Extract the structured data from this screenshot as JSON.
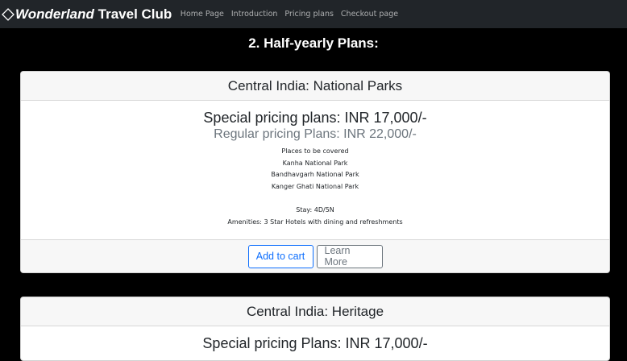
{
  "navbar": {
    "brand_part1": "Wonderland",
    "brand_part2": " Travel Club",
    "links": [
      "Home Page",
      "Introduction",
      "Pricing plans",
      "Checkout page"
    ]
  },
  "section": {
    "title": "2. Half-yearly Plans:"
  },
  "cards": [
    {
      "header": "Central India: National Parks",
      "special_price": "Special pricing plans: INR 17,000/-",
      "regular_price": "Regular pricing Plans: INR 22,000/-",
      "places_label": "Places to be covered",
      "places": [
        "Kanha National Park",
        "Bandhavgarh National Park",
        "Kanger Ghati National Park"
      ],
      "stay": "Stay: 4D/5N",
      "amenities": "Amenities: 3 Star Hotels with dining and refreshments",
      "add_to_cart_label": "Add to cart",
      "learn_more_label": "Learn More"
    },
    {
      "header": "Central India: Heritage",
      "special_price": "Special pricing Plans: INR 17,000/-"
    }
  ],
  "colors": {
    "navbar_bg": "#212529",
    "primary": "#0d6efd",
    "secondary": "#6c757d",
    "page_bg": "#000000"
  }
}
